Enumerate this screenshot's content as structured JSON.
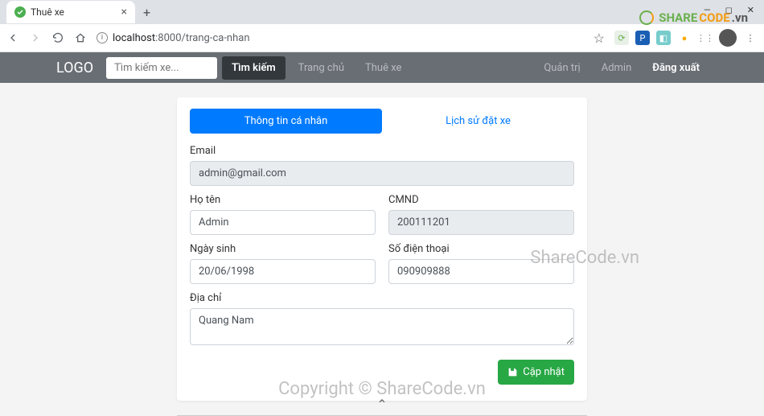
{
  "browser": {
    "tab_title": "Thuê xe",
    "url_host": "localhost",
    "url_port_path": ":8000/trang-ca-nhan"
  },
  "navbar": {
    "logo": "LOGO",
    "search_placeholder": "Tìm kiếm xe...",
    "search_button": "Tìm kiếm",
    "links": {
      "home": "Trang chủ",
      "rent": "Thuê xe",
      "admin_panel": "Quản trị",
      "admin": "Admin",
      "logout": "Đăng xuất"
    }
  },
  "tabs": {
    "profile": "Thông tin cá nhân",
    "history": "Lịch sử đặt xe"
  },
  "form": {
    "email_label": "Email",
    "email_value": "admin@gmail.com",
    "name_label": "Họ tên",
    "name_value": "Admin",
    "id_label": "CMND",
    "id_value": "200111201",
    "dob_label": "Ngày sinh",
    "dob_value": "20/06/1998",
    "phone_label": "Số điện thoại",
    "phone_value": "090909888",
    "address_label": "Địa chỉ",
    "address_value": "Quang Nam",
    "update_button": "Cập nhật"
  },
  "watermark": {
    "logo_share": "SHARE",
    "logo_code": "CODE",
    "logo_tld": ".vn",
    "text1": "ShareCode.vn",
    "footer": "Copyright © ShareCode.vn"
  }
}
